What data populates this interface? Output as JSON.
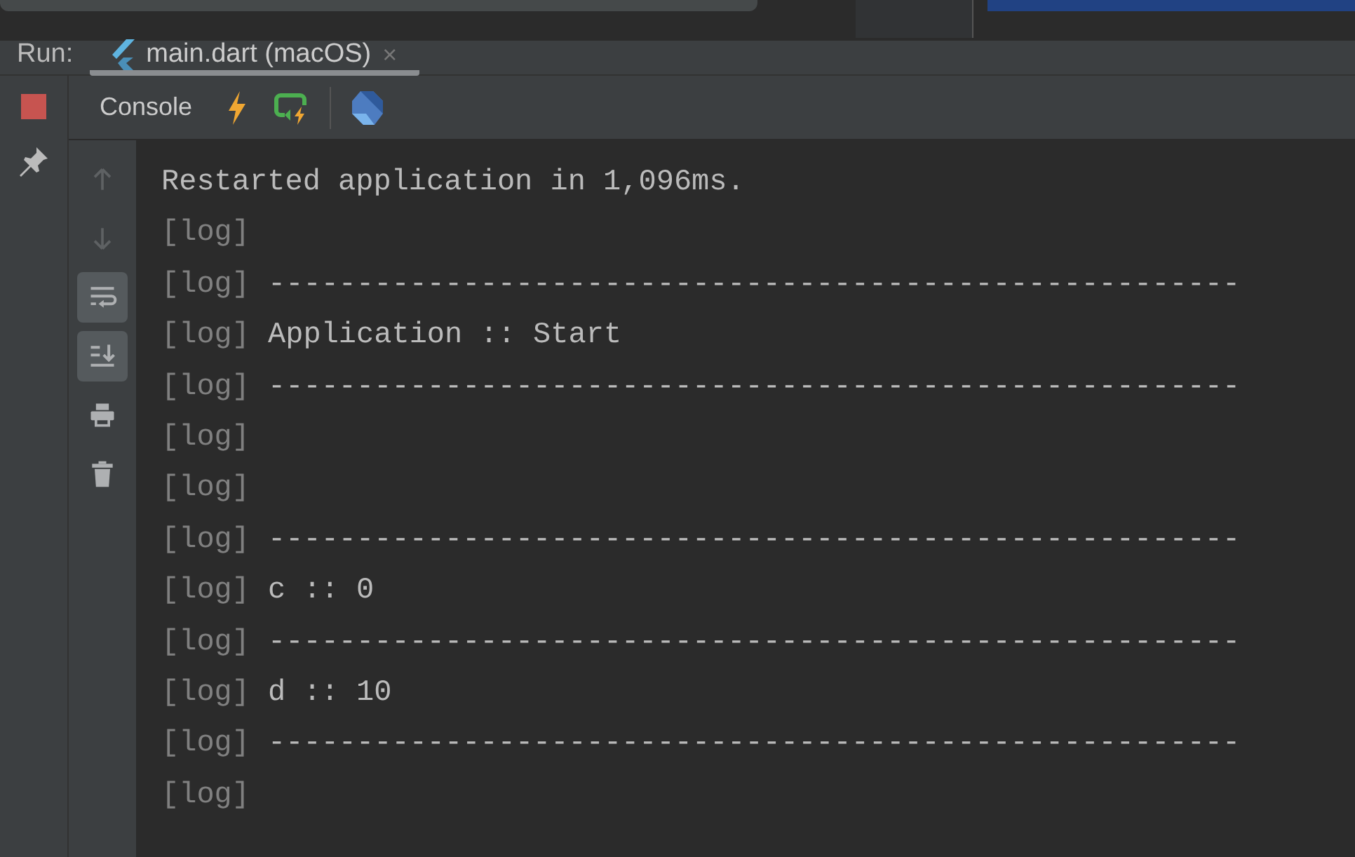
{
  "run_tab": {
    "label": "Run:",
    "tab": "main.dart (macOS)",
    "close": "×"
  },
  "toolbar": {
    "console_tab": "Console"
  },
  "side_tools": [
    {
      "kind": "up",
      "disabled": true,
      "selected": false
    },
    {
      "kind": "down",
      "disabled": true,
      "selected": false
    },
    {
      "kind": "wrap",
      "disabled": false,
      "selected": true
    },
    {
      "kind": "scroll-end",
      "disabled": false,
      "selected": true
    },
    {
      "kind": "print",
      "disabled": false,
      "selected": false
    },
    {
      "kind": "trash",
      "disabled": false,
      "selected": false
    }
  ],
  "console_lines": [
    {
      "text": "Restarted application in 1,096ms."
    },
    {
      "prefix": "[log]"
    },
    {
      "prefix": "[log]",
      "text": "-------------------------------------------------------"
    },
    {
      "prefix": "[log]",
      "text": "Application :: Start"
    },
    {
      "prefix": "[log]",
      "text": "-------------------------------------------------------"
    },
    {
      "prefix": "[log]"
    },
    {
      "prefix": "[log]"
    },
    {
      "prefix": "[log]",
      "text": "-------------------------------------------------------"
    },
    {
      "prefix": "[log]",
      "text": "c :: 0"
    },
    {
      "prefix": "[log]",
      "text": "-------------------------------------------------------"
    },
    {
      "prefix": "[log]",
      "text": "d :: 10"
    },
    {
      "prefix": "[log]",
      "text": "-------------------------------------------------------"
    },
    {
      "prefix": "[log]"
    }
  ]
}
